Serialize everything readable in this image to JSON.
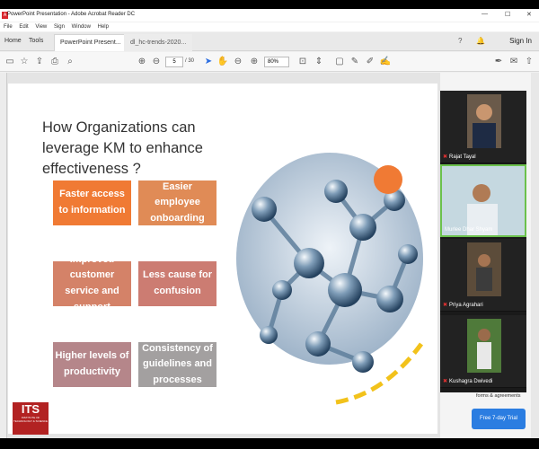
{
  "window": {
    "title": "PowerPoint Presentation - Adobe Acrobat Reader DC",
    "app_icon_glyph": "A"
  },
  "menu": [
    "File",
    "Edit",
    "View",
    "Sign",
    "Window",
    "Help"
  ],
  "tabs": {
    "home": "Home",
    "tools": "Tools",
    "documents": [
      {
        "label": "PowerPoint Present...",
        "close": "×"
      },
      {
        "label": "dl_hc-trends-2020...",
        "close": ""
      }
    ],
    "sign_in": "Sign In"
  },
  "toolbar": {
    "current_page": "5",
    "total_pages": "/ 30",
    "zoom": "80%"
  },
  "slide": {
    "title": "How Organizations can leverage KM to enhance effectiveness ?",
    "boxes": [
      "Faster access to information",
      "Easier employee onboarding",
      "Improved customer service and support",
      "Less cause for confusion",
      "Higher levels of productivity",
      "Consistency of guidelines and processes"
    ],
    "logo_text": "ITS",
    "logo_sub": "INSTITUTE OF TECHNOLOGY & SCIENCE"
  },
  "participants": [
    {
      "name": "Rajat Tayal",
      "muted": true
    },
    {
      "name": "Murlee Dhar Shyam",
      "muted": false
    },
    {
      "name": "Priya Agrahari",
      "muted": true
    },
    {
      "name": "Kushagra Dwivedi",
      "muted": true
    }
  ],
  "side_panel": {
    "text": "forms & agreements",
    "trial_button": "Free 7-day Trial"
  },
  "colors": {
    "accent_orange": "#f07a34",
    "trial_blue": "#2b7de1",
    "active_speaker": "#6bc14c"
  }
}
